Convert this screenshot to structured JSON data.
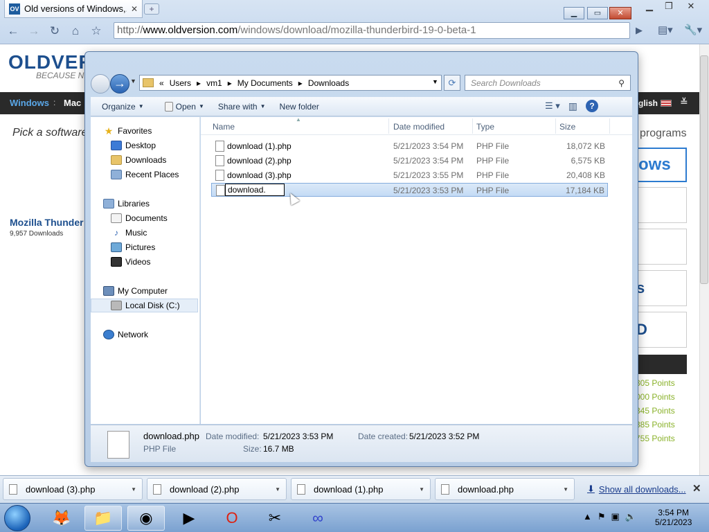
{
  "browser": {
    "tab_title": "Old versions of Windows,...",
    "tab_favicon_text": "OV",
    "url_scheme": "http://",
    "url_host": "www.oldversion.com",
    "url_path": "/windows/download/mozilla-thunderbird-19-0-beta-1"
  },
  "website": {
    "logo_text": "OLDVER",
    "slogan": "BECAUSE NEW",
    "nav_windows": "Windows",
    "nav_sep": ":",
    "nav_mac": "Mac",
    "nav_language": "glish",
    "pick_text": "Pick a software",
    "programs_text": "programs",
    "program_title": "Mozilla Thunder",
    "program_downloads": "9,957 Downloads",
    "sidebar_big_text": "ows",
    "sidebar_letter_1": "s",
    "sidebar_letter_2": "D",
    "points": [
      "305 Points",
      "000 Points",
      "345 Points",
      "385 Points",
      "755 Points"
    ]
  },
  "explorer": {
    "breadcrumb": [
      "«",
      "Users",
      "vm1",
      "My Documents",
      "Downloads"
    ],
    "search_placeholder": "Search Downloads",
    "toolbar": {
      "organize": "Organize",
      "open": "Open",
      "share_with": "Share with",
      "new_folder": "New folder"
    },
    "nav": {
      "favorites": "Favorites",
      "desktop": "Desktop",
      "downloads": "Downloads",
      "recent_places": "Recent Places",
      "libraries": "Libraries",
      "documents": "Documents",
      "music": "Music",
      "pictures": "Pictures",
      "videos": "Videos",
      "my_computer": "My Computer",
      "local_disk": "Local Disk (C:)",
      "network": "Network"
    },
    "columns": {
      "name": "Name",
      "date_modified": "Date modified",
      "type": "Type",
      "size": "Size"
    },
    "files": [
      {
        "name": "download (1).php",
        "date": "5/21/2023 3:54 PM",
        "type": "PHP File",
        "size": "18,072 KB"
      },
      {
        "name": "download (2).php",
        "date": "5/21/2023 3:54 PM",
        "type": "PHP File",
        "size": "6,575 KB"
      },
      {
        "name": "download (3).php",
        "date": "5/21/2023 3:55 PM",
        "type": "PHP File",
        "size": "20,408 KB"
      },
      {
        "name": "download.",
        "date": "5/21/2023 3:53 PM",
        "type": "PHP File",
        "size": "17,184 KB"
      }
    ],
    "details": {
      "filename": "download.php",
      "filetype": "PHP File",
      "date_modified_label": "Date modified:",
      "date_modified": "5/21/2023 3:53 PM",
      "size_label": "Size:",
      "size": "16.7 MB",
      "date_created_label": "Date created:",
      "date_created": "5/21/2023 3:52 PM"
    }
  },
  "shelf": {
    "items": [
      "download (3).php",
      "download (2).php",
      "download (1).php",
      "download.php"
    ],
    "show_all": "Show all downloads..."
  },
  "taskbar": {
    "time": "3:54 PM",
    "date": "5/21/2023"
  }
}
